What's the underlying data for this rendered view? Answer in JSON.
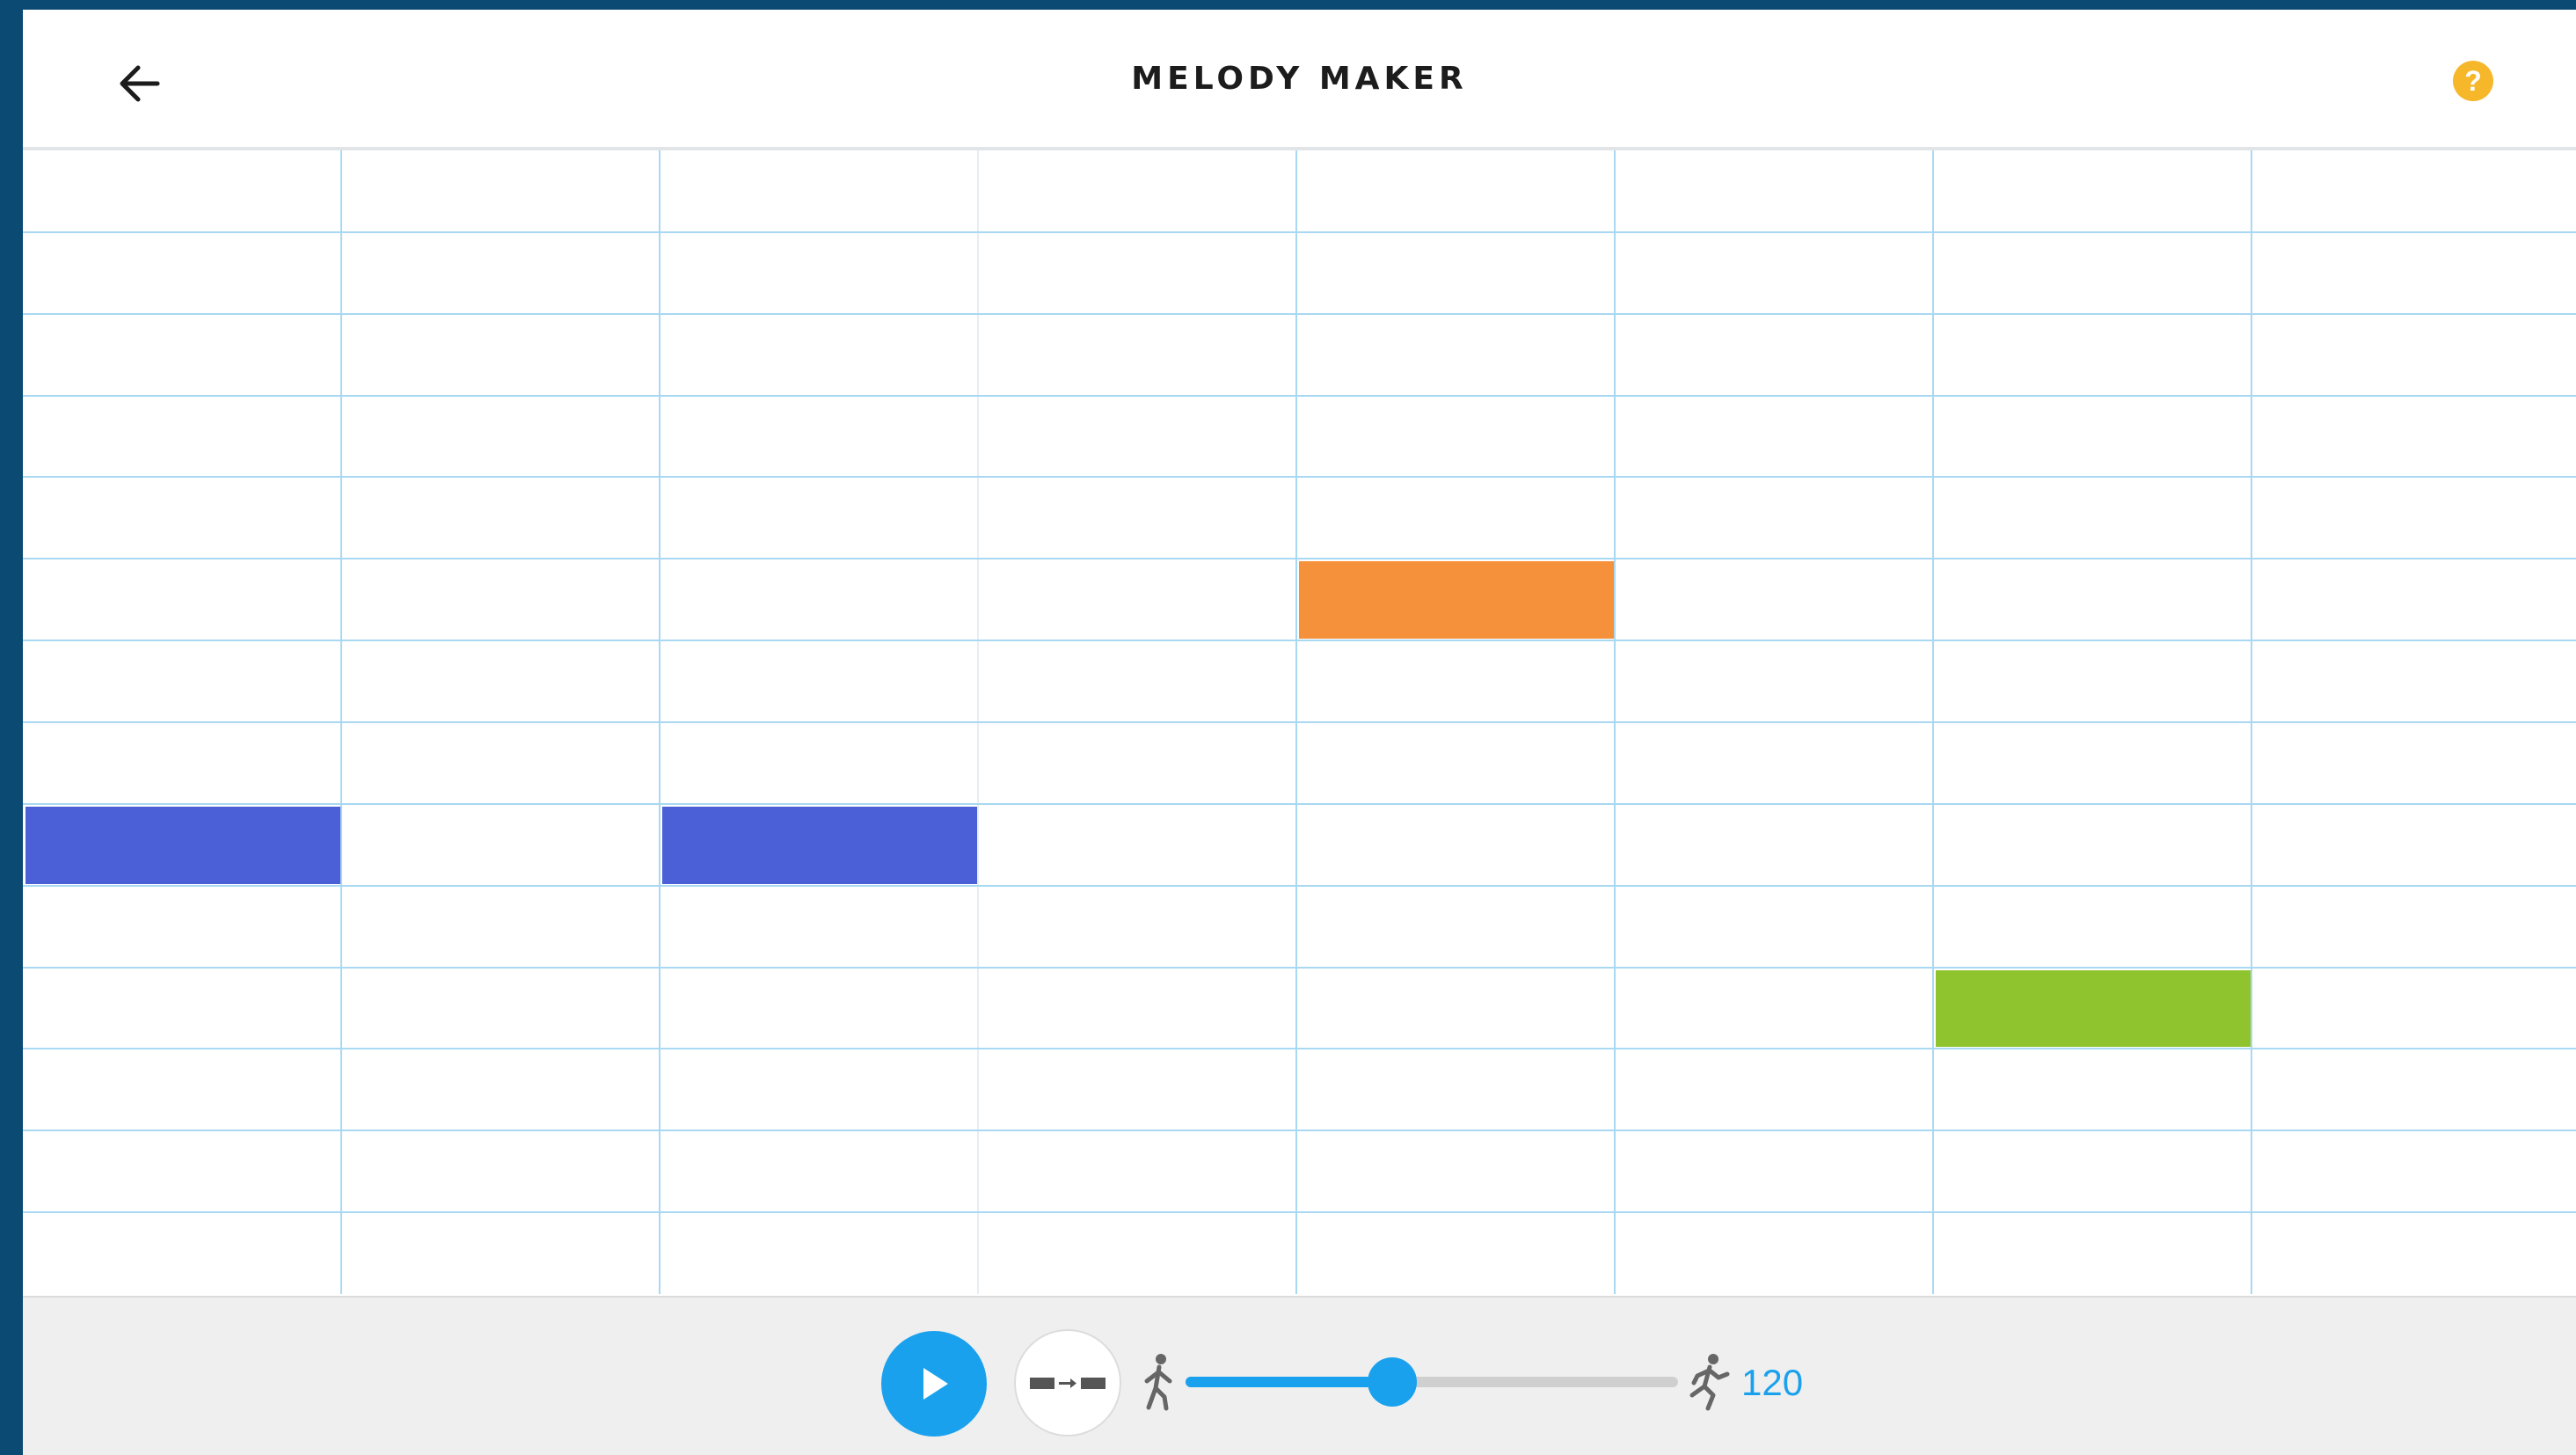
{
  "header": {
    "title": "MELODY MAKER",
    "back_icon": "arrow-left-icon",
    "help_icon": "question-mark-icon",
    "help_glyph": "?"
  },
  "grid": {
    "columns": 8,
    "rows": 14,
    "notes": [
      {
        "column": 1,
        "row": 9,
        "color": "#4b5fd6"
      },
      {
        "column": 3,
        "row": 9,
        "color": "#4b5fd6"
      },
      {
        "column": 5,
        "row": 6,
        "color": "#f5913a"
      },
      {
        "column": 7,
        "row": 11,
        "color": "#8fc42f"
      }
    ]
  },
  "controls": {
    "play_icon": "play-icon",
    "arpeggio_icon": "arpeggio-icon",
    "tempo_min_icon": "walking-person-icon",
    "tempo_max_icon": "running-person-icon",
    "tempo_fraction": 0.42,
    "tempo_value": "120"
  },
  "colors": {
    "accent": "#1aa1ee",
    "help": "#f6b82a",
    "grid_line": "#a9d8f2"
  }
}
